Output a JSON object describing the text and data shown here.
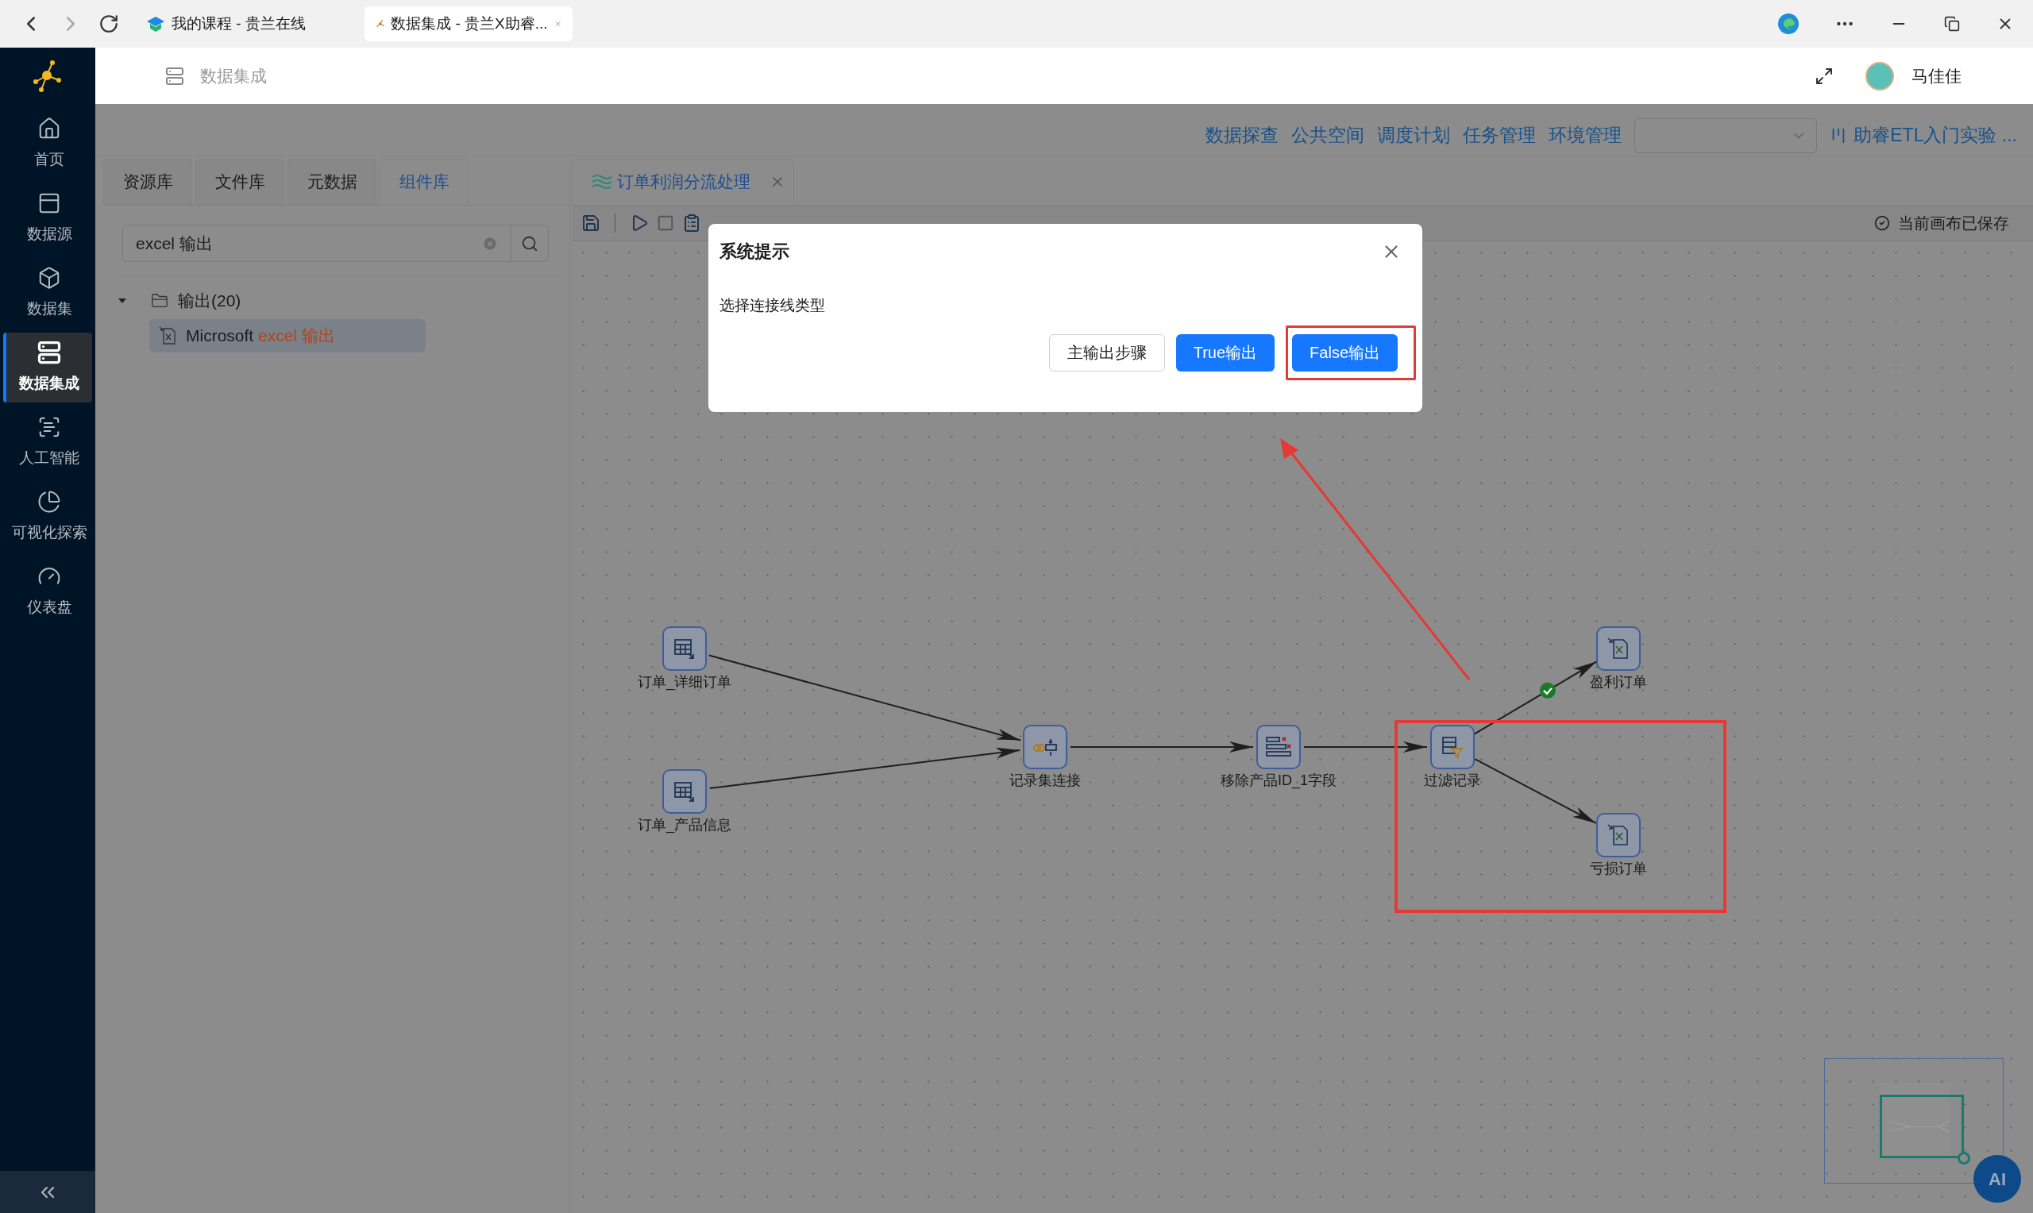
{
  "browser": {
    "tabs": [
      {
        "title": "我的课程 - 贵兰在线",
        "selected": false
      },
      {
        "title": "数据集成 - 贵兰X助睿...",
        "selected": true
      }
    ]
  },
  "header": {
    "breadcrumb": "数据集成",
    "user": "马佳佳"
  },
  "sidebar": {
    "items": [
      {
        "label": "首页",
        "selected": false
      },
      {
        "label": "数据源",
        "selected": false
      },
      {
        "label": "数据集",
        "selected": false
      },
      {
        "label": "数据集成",
        "selected": true
      },
      {
        "label": "人工智能",
        "selected": false
      },
      {
        "label": "可视化探索",
        "selected": false
      },
      {
        "label": "仪表盘",
        "selected": false
      }
    ]
  },
  "top_nav": {
    "links": [
      "数据探查",
      "公共空间",
      "调度计划",
      "任务管理",
      "环境管理"
    ],
    "project": "助睿ETL入门实验 ..."
  },
  "left_panel": {
    "tabs": [
      {
        "label": "资源库",
        "selected": false
      },
      {
        "label": "文件库",
        "selected": false
      },
      {
        "label": "元数据",
        "selected": false
      },
      {
        "label": "组件库",
        "selected": true
      }
    ],
    "search": {
      "value": "excel 输出"
    },
    "tree": [
      {
        "label": "输出(20)",
        "expanded": true,
        "children": [
          {
            "label": "Microsoft ",
            "match": "excel 输出",
            "selected": true
          }
        ]
      }
    ]
  },
  "canvas": {
    "tab": {
      "title": "订单利润分流处理"
    },
    "status": "当前画布已保存",
    "nodes": [
      {
        "label": "订单_详细订单",
        "kind": "table_input"
      },
      {
        "label": "订单_产品信息",
        "kind": "table_input"
      },
      {
        "label": "记录集连接",
        "kind": "join"
      },
      {
        "label": "移除产品ID_1字段",
        "kind": "remove_fields"
      },
      {
        "label": "过滤记录",
        "kind": "filter"
      },
      {
        "label": "盈利订单",
        "kind": "excel_output"
      },
      {
        "label": "亏损订单",
        "kind": "excel_output"
      }
    ],
    "edges": [
      {
        "kind": "normal"
      },
      {
        "kind": "normal"
      },
      {
        "kind": "normal"
      },
      {
        "kind": "normal"
      },
      {
        "kind": "true"
      },
      {
        "kind": "normal"
      }
    ]
  },
  "dialog": {
    "title": "系统提示",
    "message": "选择连接线类型",
    "buttons": [
      {
        "label": "主输出步骤",
        "kind": "default",
        "highlighted": false
      },
      {
        "label": "True输出",
        "kind": "primary",
        "highlighted": false
      },
      {
        "label": "False输出",
        "kind": "primary",
        "highlighted": true
      }
    ]
  },
  "ai_button": {
    "label": "AI"
  }
}
